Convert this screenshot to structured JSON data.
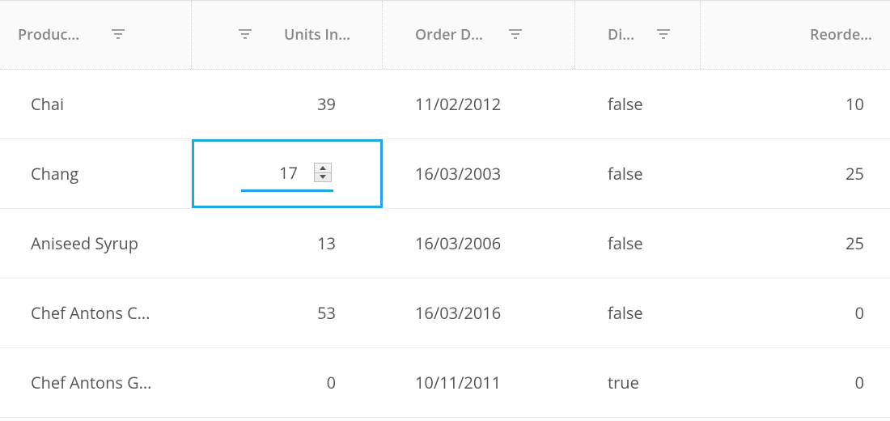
{
  "columns": {
    "product": "Produc...",
    "units": "Units In...",
    "orderDate": "Order D...",
    "disc": "Di...",
    "reorder": "Reorde..."
  },
  "editing": {
    "value": "17"
  },
  "rows": [
    {
      "product": "Chai",
      "units": "39",
      "orderDate": "11/02/2012",
      "disc": "false",
      "reorder": "10"
    },
    {
      "product": "Chang",
      "units": "17",
      "orderDate": "16/03/2003",
      "disc": "false",
      "reorder": "25"
    },
    {
      "product": "Aniseed Syrup",
      "units": "13",
      "orderDate": "16/03/2006",
      "disc": "false",
      "reorder": "25"
    },
    {
      "product": "Chef Antons C...",
      "units": "53",
      "orderDate": "16/03/2016",
      "disc": "false",
      "reorder": "0"
    },
    {
      "product": "Chef Antons G...",
      "units": "0",
      "orderDate": "10/11/2011",
      "disc": "true",
      "reorder": "0"
    }
  ]
}
